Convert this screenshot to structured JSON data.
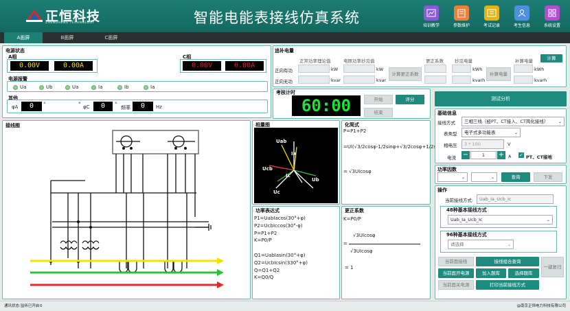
{
  "header": {
    "brand": "正恒科技",
    "brand_en": "ZHENGHENG TECHNOLOGY",
    "title": "智能电能表接线仿真系统",
    "buttons": [
      {
        "label": "培训教学",
        "icon": "chart-icon",
        "color": "#8a5bd6"
      },
      {
        "label": "参数维护",
        "icon": "document-icon",
        "color": "#e8823a"
      },
      {
        "label": "考试记录",
        "icon": "list-icon",
        "color": "#e0b51a"
      },
      {
        "label": "考生信息",
        "icon": "user-icon",
        "color": "#4f8fe0"
      },
      {
        "label": "系统设置",
        "icon": "grid-icon",
        "color": "#b04fd0"
      }
    ]
  },
  "tabs": [
    "A面屏",
    "B面屏",
    "C面屏"
  ],
  "power_status": {
    "title": "电源状态",
    "phaseA": {
      "label": "A相",
      "voltage": "0.00V",
      "current": "0.00A"
    },
    "phaseC": {
      "label": "C相",
      "voltage": "0.00V",
      "current": "0.00A"
    },
    "alarm_title": "电源报警",
    "alarms": [
      "Ua",
      "Ub",
      "Ua",
      "Ia",
      "Ib",
      "Ia"
    ],
    "angle_title": "其他",
    "phiA_label": "φA",
    "phiA_value": "0",
    "phiC_label": "φC",
    "phiC_value": "0",
    "freq_label": "频率",
    "freq_value": "0",
    "freq_unit": "Hz",
    "degree": "°"
  },
  "energy": {
    "title": "追补电量",
    "col1": "正常功率理论值",
    "col2": "电原功率抄见值",
    "col3": "更正系数",
    "col4": "抄见电量",
    "col5": "补算电量",
    "row1": "正向有功",
    "row2": "正向无功",
    "unit_kw": "kW",
    "unit_kvar": "kvar",
    "unit_kwh": "kWh",
    "unit_kvarh": "kvarh",
    "btn_calc_corr": "计算更正系数",
    "btn_calc_energy": "补算电量",
    "btn_calc": "计算"
  },
  "timer": {
    "title": "考核计时",
    "value": "60:00",
    "btn_start": "开始",
    "btn_grade": "评分",
    "btn_end": "结束"
  },
  "wiring": {
    "title": "接线图"
  },
  "phasor": {
    "title": "相量图",
    "labels": [
      "Uab",
      "Ia",
      "Ucb",
      "Ic",
      "Ub",
      "Uc"
    ]
  },
  "simplify": {
    "title": "化简式",
    "lines": [
      "P=P1+P2",
      "=UI(√3/2cosφ-1/2sinφ+√3/2cosφ+1/2sinφ)",
      "= √3UIcosφ"
    ]
  },
  "power_expr": {
    "title": "功率表达式",
    "lines": [
      "P1=UabIacos(30°+φ)",
      "P2=UcbIccos(30°-φ)",
      "P=P1+P2",
      "K=P0/P",
      "",
      "Q1=UabIasin(30°+φ)",
      "Q2=UcbIcsin(330°+φ)",
      "Q=Q1+Q2",
      "K=Q0/Q"
    ]
  },
  "correction": {
    "title": "更正系数",
    "line1": "K=P0/P",
    "numerator": "√3UIcosφ",
    "eq": "=",
    "denominator": "√3UIcosφ",
    "result": "=  1"
  },
  "right": {
    "btn_test": "测试分析",
    "basic_title": "基础信息",
    "mode_label": "接线方式",
    "mode_value": "三相三线（经PT、CT接入、CT简化接线）",
    "meter_label": "表类型",
    "meter_value": "电子式多功能表",
    "voltage_label": "相电压",
    "voltage_placeholder": "3 * 100",
    "voltage_unit": "V",
    "current_label": "电流",
    "current_value": "1",
    "current_unit": "A",
    "ground_label": "PT、CT接地",
    "factor_title": "功率因数",
    "btn_query": "查询",
    "btn_download": "下发",
    "op_title": "操作",
    "current_mode_label": "当前接线方式:",
    "current_mode_value": "Uab_Ia_Ucb_Ic",
    "basic48_title": "48种基本接线方式",
    "basic48_value": "Uab_Ia_Ucb_Ic",
    "basic96_title": "96种基本接线方式",
    "basic96_value": "请选择",
    "btn_cur_wiring": "当前面接线",
    "btn_combo_query": "接线组合查询",
    "btn_reset": "一键复归",
    "btn_open_power": "当前面开电源",
    "btn_add_lib": "加入题库",
    "btn_select_lib": "选择题库",
    "btn_close_power": "当前面关电源",
    "btn_print": "打印当前接线方式"
  },
  "status": {
    "left": "通讯状态:监听已开启",
    "count": "0",
    "right": "@南京正恒电力科技有限公司"
  }
}
